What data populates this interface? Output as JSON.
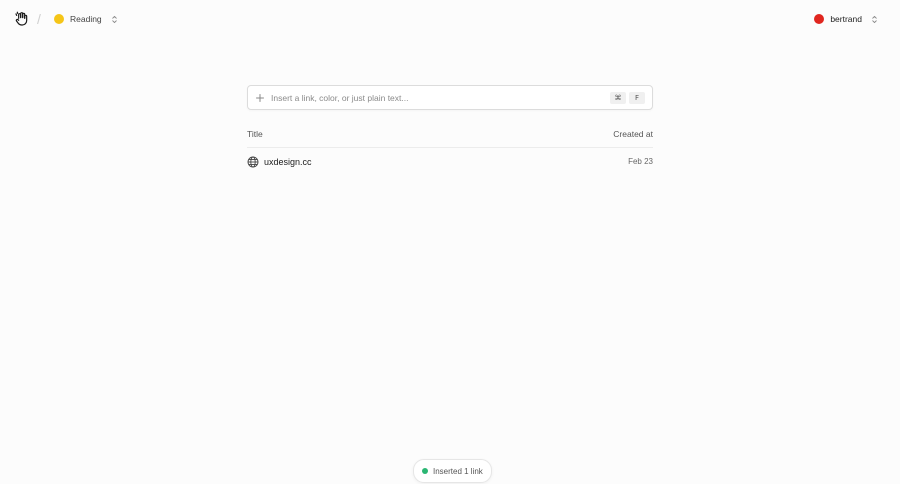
{
  "header": {
    "board": {
      "name": "Reading",
      "color": "#f5c518"
    },
    "user": {
      "name": "bertrand",
      "color": "#e0261f"
    }
  },
  "search": {
    "placeholder": "Insert a link, color, or just plain text...",
    "value": "",
    "shortcut": [
      "⌘",
      "F"
    ]
  },
  "table": {
    "columns": [
      "Title",
      "Created at"
    ],
    "rows": [
      {
        "title": "uxdesign.cc",
        "created_at": "Feb 23",
        "icon": "globe-icon"
      }
    ]
  },
  "toast": {
    "text": "Inserted 1 link",
    "status_color": "#2bb673"
  },
  "colors": {
    "background": "#fcfcfc",
    "board_dot": "#f5c518",
    "user_dot": "#e0261f",
    "success": "#2bb673"
  }
}
